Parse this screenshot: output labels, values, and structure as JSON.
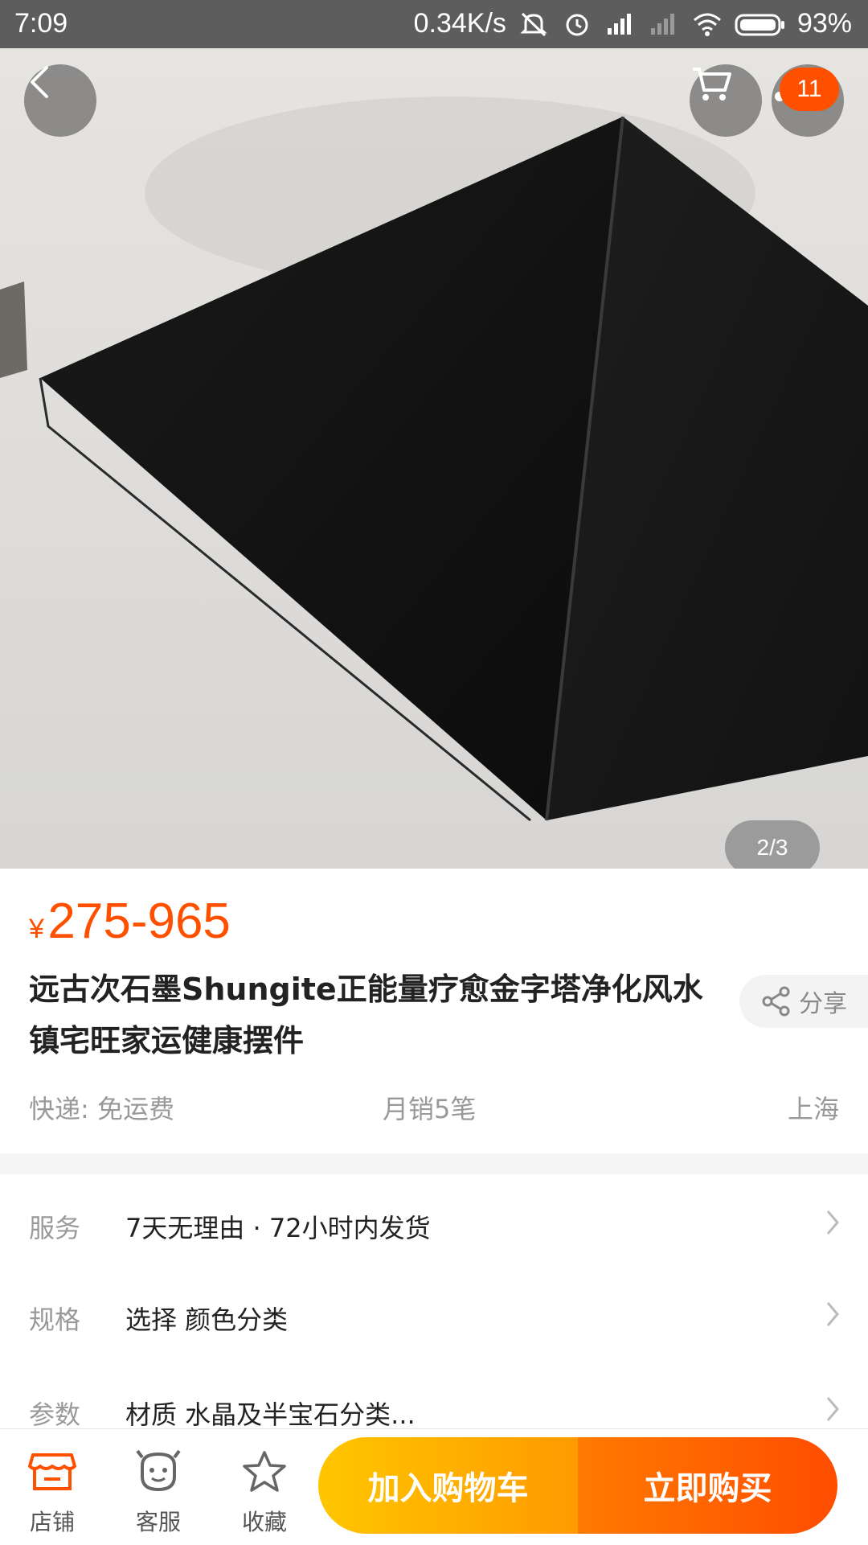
{
  "status_bar": {
    "time": "7:09",
    "net_speed": "0.34K/s",
    "battery": "93%"
  },
  "hero": {
    "cart_badge": "11",
    "pager": "2/3"
  },
  "product": {
    "currency": "¥",
    "price": "275-965",
    "title": "远古次石墨Shungite正能量疗愈金字塔净化风水镇宅旺家运健康摆件",
    "share_label": "分享",
    "shipping": "快递: 免运费",
    "monthly_sales": "月销5笔",
    "location": "上海"
  },
  "details": [
    {
      "label": "服务",
      "value": "7天无理由 · 72小时内发货"
    },
    {
      "label": "规格",
      "value": "选择 颜色分类"
    },
    {
      "label": "参数",
      "value": "材质 水晶及半宝石分类..."
    }
  ],
  "bottom": {
    "store_label": "店铺",
    "service_label": "客服",
    "favorite_label": "收藏",
    "add_to_cart_label": "加入购物车",
    "buy_now_label": "立即购买"
  },
  "colors": {
    "accent": "#ff5000",
    "cart_button": "#ffb400",
    "buy_button": "#ff5a00"
  }
}
